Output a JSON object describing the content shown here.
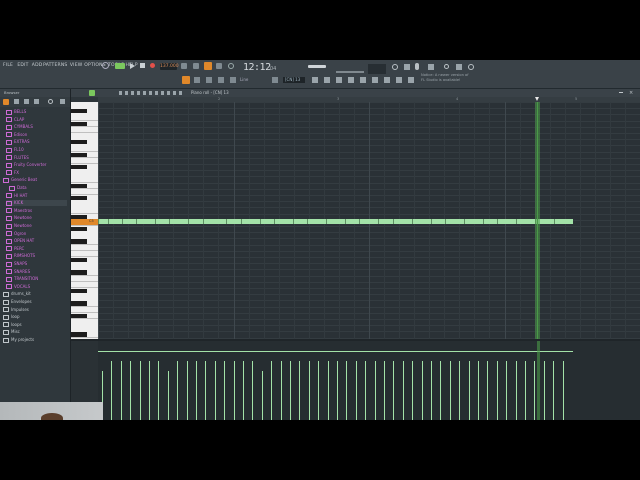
{
  "menu": {
    "items": [
      "FILE",
      "EDIT",
      "ADD",
      "PATTERNS",
      "VIEW",
      "OPTIONS",
      "TOOLS",
      "HELP"
    ]
  },
  "transport": {
    "tempo": "137.000",
    "time": "12:12",
    "time_sub": "04",
    "mode_label": "PAT",
    "pattern_label": "[CN] 13"
  },
  "notice": {
    "line1": "Notice: A newer version of",
    "line2": "FL Studio is available!"
  },
  "snap": {
    "label": "Line"
  },
  "browser": {
    "header": "Browser",
    "items": [
      {
        "label": "BELLS",
        "color": "pink",
        "indent": 1
      },
      {
        "label": "CLAP",
        "color": "pink",
        "indent": 1
      },
      {
        "label": "CYMBALS",
        "color": "pink",
        "indent": 1
      },
      {
        "label": "Edison",
        "color": "pink",
        "indent": 1
      },
      {
        "label": "EXTRAS",
        "color": "pink",
        "indent": 1
      },
      {
        "label": "FL10",
        "color": "pink",
        "indent": 1
      },
      {
        "label": "FLUTES",
        "color": "pink",
        "indent": 1
      },
      {
        "label": "Fruity Converter",
        "color": "pink",
        "indent": 1
      },
      {
        "label": "FX",
        "color": "pink",
        "indent": 1
      },
      {
        "label": "Generic Beat",
        "color": "pink",
        "indent": 0
      },
      {
        "label": "Data",
        "color": "pink",
        "indent": 2
      },
      {
        "label": "HI HAT",
        "color": "pink",
        "indent": 1
      },
      {
        "label": "KICK",
        "color": "pink",
        "indent": 1,
        "selected": true
      },
      {
        "label": "Maestros",
        "color": "pink",
        "indent": 1
      },
      {
        "label": "Newtone",
        "color": "pink",
        "indent": 1
      },
      {
        "label": "Newtone",
        "color": "pink",
        "indent": 1
      },
      {
        "label": "Ogron",
        "color": "pink",
        "indent": 1
      },
      {
        "label": "OPEN HAT",
        "color": "pink",
        "indent": 1
      },
      {
        "label": "PERC",
        "color": "pink",
        "indent": 1
      },
      {
        "label": "RIMSHOTS",
        "color": "pink",
        "indent": 1
      },
      {
        "label": "SNAPS",
        "color": "pink",
        "indent": 1
      },
      {
        "label": "SNARES",
        "color": "pink",
        "indent": 1
      },
      {
        "label": "TRANSITION",
        "color": "pink",
        "indent": 1
      },
      {
        "label": "VOCALS",
        "color": "pink",
        "indent": 1
      },
      {
        "label": "drums_kit",
        "color": "grey",
        "indent": 0
      },
      {
        "label": "Envelopes",
        "color": "grey",
        "indent": 0
      },
      {
        "label": "Impulses",
        "color": "grey",
        "indent": 0
      },
      {
        "label": "loop",
        "color": "grey",
        "indent": 0
      },
      {
        "label": "loops",
        "color": "grey",
        "indent": 0
      },
      {
        "label": "Misc",
        "color": "grey",
        "indent": 0
      },
      {
        "label": "My projects",
        "color": "grey",
        "indent": 0
      }
    ]
  },
  "pianoroll": {
    "title": "Piano roll - [CN] 13",
    "ruler": [
      "2",
      "3",
      "4",
      "5"
    ],
    "note_row_label": "C5",
    "notes": [
      0,
      0.02,
      0.05,
      0.08,
      0.12,
      0.15,
      0.19,
      0.22,
      0.27,
      0.3,
      0.34,
      0.37,
      0.41,
      0.44,
      0.48,
      0.52,
      0.55,
      0.59,
      0.62,
      0.66,
      0.7,
      0.73,
      0.77,
      0.81,
      0.84,
      0.88,
      0.92,
      0.96
    ],
    "velocities": [
      0.62,
      0.75,
      0.75,
      0.75,
      0.75,
      0.75,
      0.75,
      0.62,
      0.75,
      0.75,
      0.75,
      0.75,
      0.75,
      0.75,
      0.75,
      0.75,
      0.75,
      0.62,
      0.75,
      0.75,
      0.75,
      0.75,
      0.75,
      0.75,
      0.75,
      0.75,
      0.75,
      0.75,
      0.75,
      0.75,
      0.75,
      0.75,
      0.75,
      0.75,
      0.75,
      0.75,
      0.75,
      0.75,
      0.75,
      0.75,
      0.75,
      0.75,
      0.75,
      0.75,
      0.75,
      0.75,
      0.75,
      0.75,
      0.75,
      0.75
    ],
    "playhead_fraction": 0.81
  },
  "colors": {
    "note_fill": "#a3e2a8",
    "playhead": "#4a9a48",
    "accent_orange": "#e0882a",
    "browser_pink": "#d06bd8"
  },
  "icons": [
    "search-icon",
    "gear-icon",
    "mic-icon",
    "play-icon",
    "stop-icon",
    "record-icon",
    "magnet-icon",
    "pencil-icon",
    "folder-icon"
  ]
}
